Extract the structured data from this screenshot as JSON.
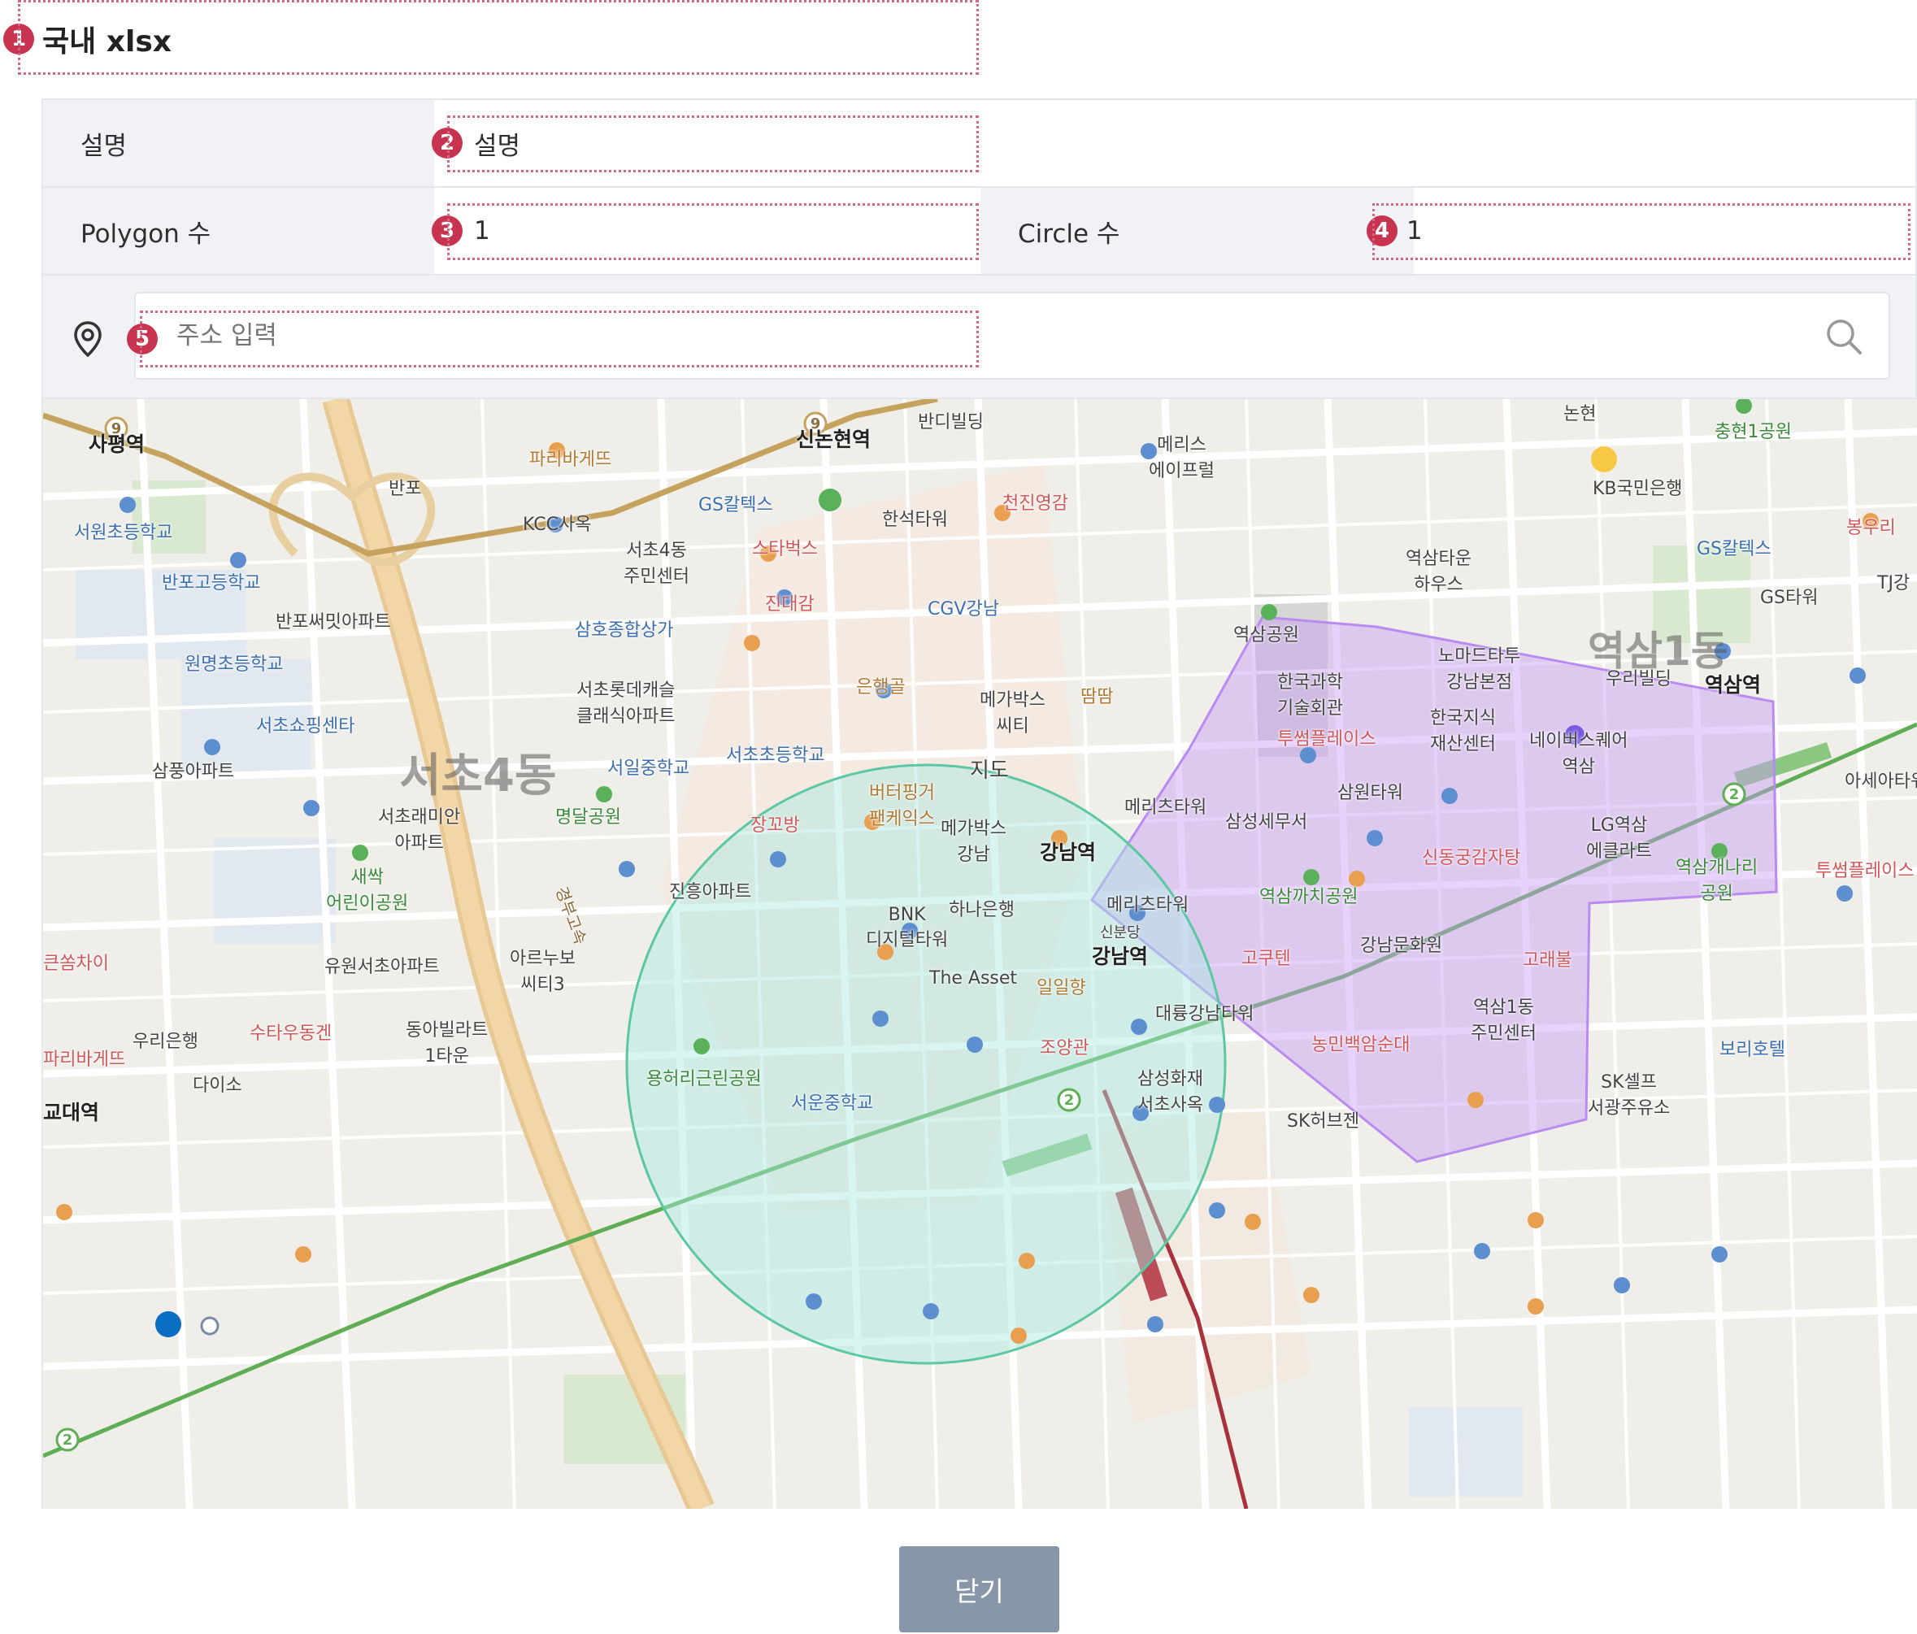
{
  "title": "국내 xlsx",
  "badges": [
    "1",
    "2",
    "3",
    "4",
    "5"
  ],
  "fields": {
    "description_label": "설명",
    "description_value": "설명",
    "polygon_label": "Polygon 수",
    "polygon_value": "1",
    "circle_label": "Circle 수",
    "circle_value": "1"
  },
  "search": {
    "placeholder": "주소 입력",
    "pin_icon": "location-pin-icon",
    "search_icon": "search-icon"
  },
  "map": {
    "labels": {
      "sapyeong": "사평역",
      "paris1": "파리바게뜨",
      "sinnonhyeon": "신논현역",
      "bandi": "반디빌딩",
      "meris": "메리스\n에이프럴",
      "nonhyeon": "논현",
      "chunghyeon": "충현1공원",
      "banpo_ic": "반포",
      "gs1": "GS칼텍스",
      "kb": "KB국민은행",
      "seowon": "서원초등학교",
      "kcc": "KCC사옥",
      "hanseok": "한석타워",
      "cheonjin": "천진영감",
      "bongwuri": "봉우리",
      "seocho4_center": "서초4동\n주민센터",
      "starbucks": "스타벅스",
      "yeoksam_town": "역삼타운\n하우스",
      "gs2": "GS칼텍스",
      "banpo_high": "반포고등학교",
      "jindaegam": "진대감",
      "cgv": "CGV강남",
      "gs_tower": "GS타워",
      "tj": "TJ강",
      "banpo_xi": "반포써밋아파트",
      "samho": "삼호종합상가",
      "yeoksam_park": "역삼공원",
      "nomad": "노마드타투\n강남본점",
      "yeoksam1dong": "역삼1동",
      "wonmyeong": "원명초등학교",
      "eunhaenggol": "은행골",
      "ttamttam": "땀땀",
      "science": "한국과학\n기술회관",
      "woori_building": "우리빌딩",
      "yeoksam_station": "역삼역",
      "lotte": "서초롯데캐슬\n클래식아파트",
      "megabox": "메가박스\n씨티",
      "seocho_shopping": "서초쇼핑센타",
      "seocho_elem": "서초초등학교",
      "twosome1": "투썸플레이스",
      "knowledge": "한국지식\n재산센터",
      "naver_square": "네이버스퀘어\n역삼",
      "asia_tower": "아세아타워",
      "sampung": "삼풍아파트",
      "seocho4dong": "서초4동",
      "seoil": "서일중학교",
      "jido": "지도",
      "samwon": "삼원타워",
      "raemian": "서초래미안\n아파트",
      "myeongdal": "명달공원",
      "butter": "버터핑거\n팬케익스",
      "janggobang": "장꼬방",
      "mega_tower": "메리츠타워",
      "samsung_tax": "삼성세무서",
      "lg_yeoksam": "LG역삼\n에클라트",
      "megabox_gangnam": "메가박스\n강남",
      "gangnam_station": "강남역",
      "sindong": "신동궁감자탕",
      "yeoksam_gaenari": "역삼개나리\n공원",
      "twosome2": "투썸플레이스",
      "saessak": "새싹\n어린이공원",
      "jinheung": "진흥아파트",
      "hana": "하나은행",
      "meritz": "메리츠타워",
      "yeoksam_kkachi": "역삼까치공원",
      "bnk": "BNK\n디지털타워",
      "sinbundang": "신분당",
      "gangnam_station2": "강남역",
      "kkeumchai": "큰쏨차이",
      "yuwon": "유원서초아파트",
      "arinubo": "아르누보\n씨티3",
      "the_asset": "The Asset",
      "ilpumyang": "일일향",
      "gokuten": "고쿠텐",
      "gangnam_culture": "강남문화원",
      "goraebul": "고래불",
      "woori_bank": "우리은행",
      "tabarugen": "수타우동겐",
      "dongabillarat": "동아빌라트\n1타운",
      "daeryung": "대륭강남타워",
      "yeoksam1_center": "역삼1동\n주민센터",
      "paris2": "파리바게뜨",
      "daiso": "다이소",
      "yongheori": "용허리근린공원",
      "joyanggwan": "조양관",
      "nongmin": "농민백암순대",
      "bori": "보리호텔",
      "samsung_fire": "삼성화재\n서초사옥",
      "sk_self": "SK셀프\n서광주유소",
      "seoun": "서운중학교",
      "sk_hub": "SK허브젠",
      "gyodae": "교대역",
      "expressway": "경부고속"
    }
  },
  "close_label": "닫기"
}
